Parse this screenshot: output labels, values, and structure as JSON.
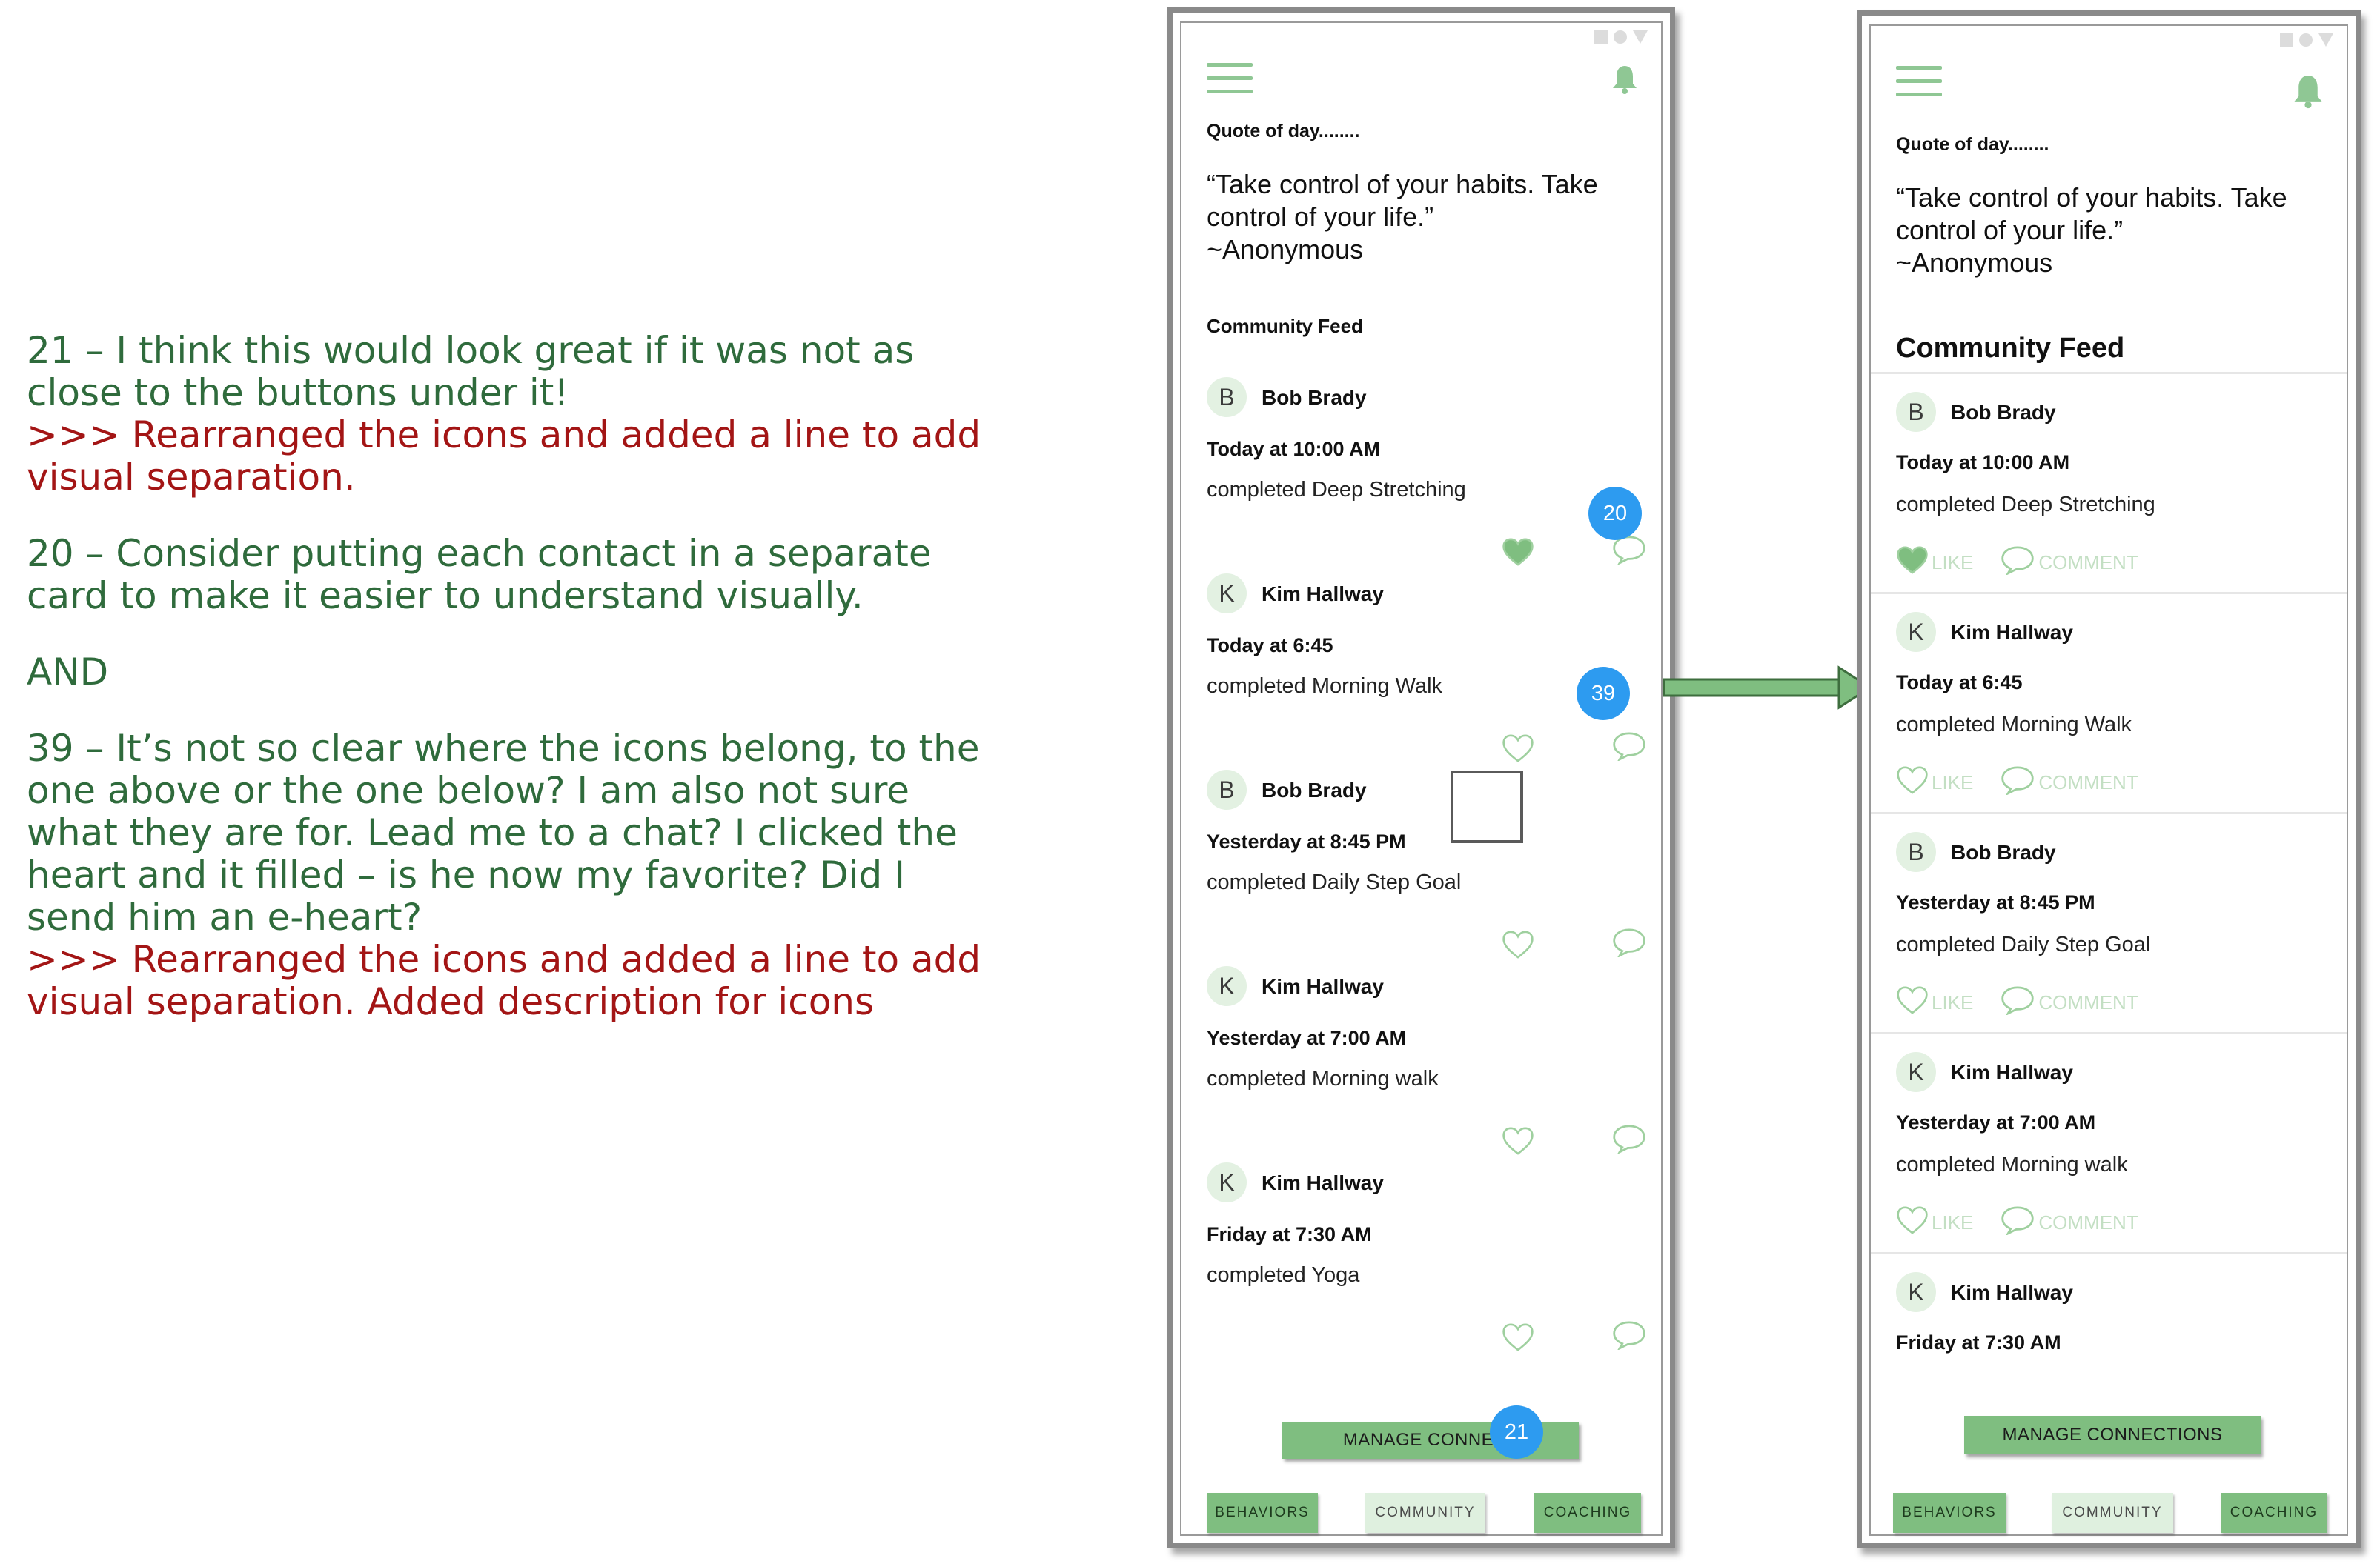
{
  "notes": [
    {
      "color": "green",
      "text": "21 – I think this would look great if it was not as close to the buttons under it!"
    },
    {
      "color": "red",
      "text": ">>> Rearranged the icons and added a line to add visual separation."
    },
    {
      "color": "green",
      "text": "20 – Consider putting each contact in a separate card to make it easier to understand visually."
    },
    {
      "color": "green",
      "text": "AND"
    },
    {
      "color": "green",
      "text": "39 – It’s not so clear where the icons belong, to the one above or the one below? I am also not sure what they are for. Lead me to a chat? I clicked the heart and it filled – is he now my favorite? Did I send him an e-heart?"
    },
    {
      "color": "red",
      "text": ">>> Rearranged the icons and added a line to add visual separation. Added description for icons"
    }
  ],
  "quote_heading": "Quote of day........",
  "quote_text": "“Take control of your habits. Take control of your life.”\n~Anonymous",
  "feed_heading": "Community Feed",
  "posts_before": [
    {
      "initial": "B",
      "name": "Bob Brady",
      "time": "Today at 10:00 AM",
      "activity": "completed Deep Stretching",
      "liked": true
    },
    {
      "initial": "K",
      "name": "Kim Hallway",
      "time": "Today at 6:45",
      "activity": "completed Morning Walk",
      "liked": false
    },
    {
      "initial": "B",
      "name": "Bob Brady",
      "time": "Yesterday at 8:45 PM",
      "activity": "completed Daily Step Goal",
      "liked": false
    },
    {
      "initial": "K",
      "name": "Kim Hallway",
      "time": "Yesterday  at 7:00 AM",
      "activity": "completed Morning walk",
      "liked": false
    },
    {
      "initial": "K",
      "name": "Kim Hallway",
      "time": "Friday at 7:30 AM",
      "activity": "completed Yoga",
      "liked": false
    }
  ],
  "posts_after": [
    {
      "initial": "B",
      "name": "Bob Brady",
      "time": "Today at 10:00 AM",
      "activity": "completed Deep Stretching",
      "liked": true
    },
    {
      "initial": "K",
      "name": "Kim Hallway",
      "time": "Today at 6:45",
      "activity": "completed Morning Walk",
      "liked": false
    },
    {
      "initial": "B",
      "name": "Bob Brady",
      "time": "Yesterday at 8:45 PM",
      "activity": "completed Daily Step Goal",
      "liked": false
    },
    {
      "initial": "K",
      "name": "Kim Hallway",
      "time": "Yesterday  at 7:00 AM",
      "activity": "completed Morning walk",
      "liked": false
    },
    {
      "initial": "K",
      "name": "Kim Hallway",
      "time": "Friday at 7:30 AM",
      "activity": "",
      "liked": false
    }
  ],
  "like_label": "LIKE",
  "comment_label": "COMMENT",
  "manage_label_before": "MANAGE CONNECT",
  "manage_label_after": "MANAGE CONNECTIONS",
  "nav": {
    "behaviors": "BEHAVIORS",
    "community": "COMMUNITY",
    "coaching": "COACHING"
  },
  "badges": {
    "b20": "20",
    "b39": "39",
    "b21": "21"
  },
  "colors": {
    "accent_green": "#7fbe80",
    "light_green": "#c3dfc3",
    "badge_blue": "#2d9bf0",
    "note_green": "#2f6b3c",
    "note_red": "#a31515"
  },
  "icons": {
    "menu": "hamburger-menu-icon",
    "bell": "bell-icon",
    "heart": "heart-icon",
    "comment": "speech-bubble-icon",
    "arrow": "right-arrow-icon"
  }
}
